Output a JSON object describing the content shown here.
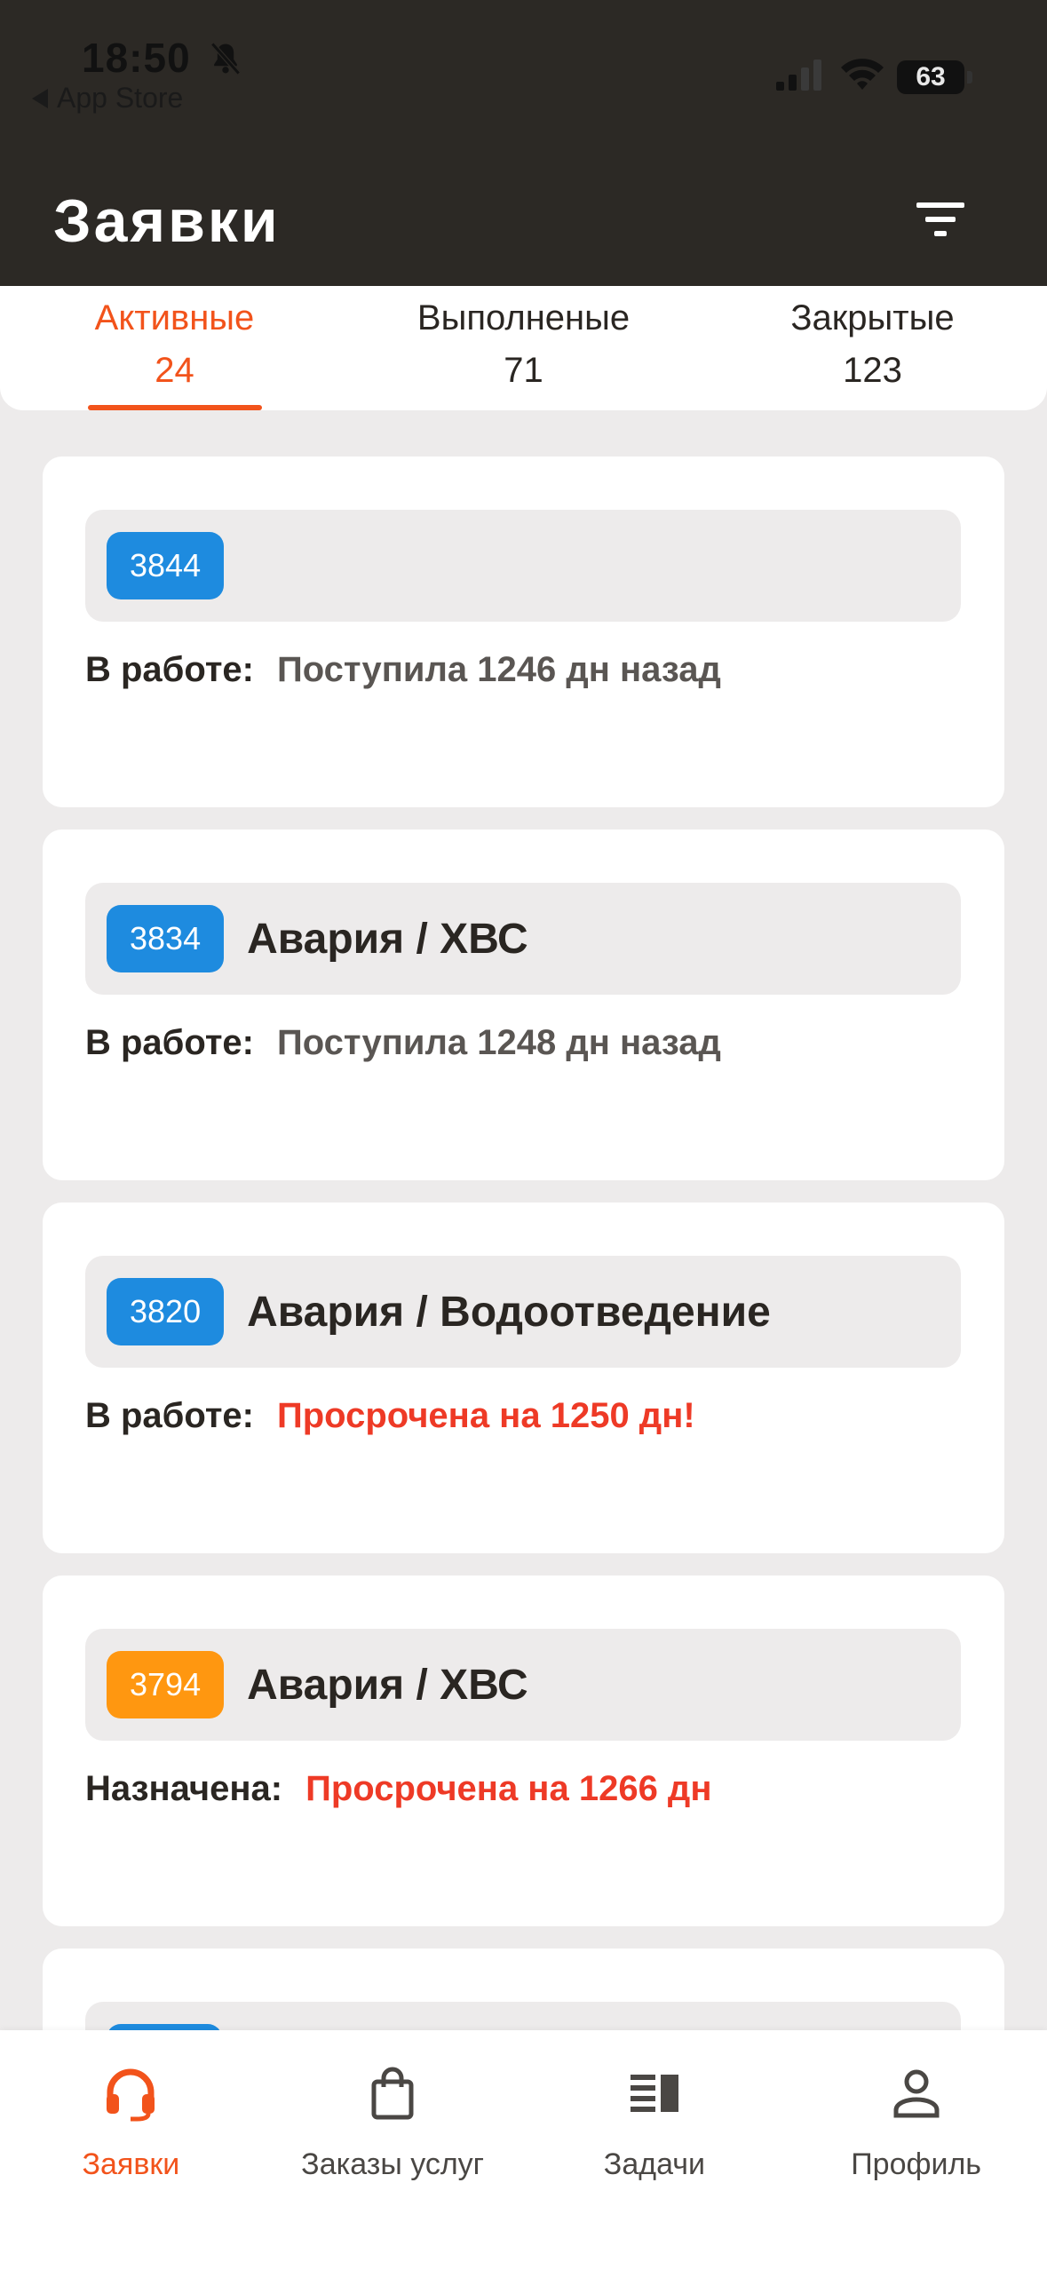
{
  "status_bar": {
    "time": "18:50",
    "back_app": "App Store",
    "battery": "63"
  },
  "header": {
    "title": "Заявки"
  },
  "tabs": [
    {
      "label": "Активные",
      "count": "24"
    },
    {
      "label": "Выполненые",
      "count": "71"
    },
    {
      "label": "Закрытые",
      "count": "123"
    }
  ],
  "requests": [
    {
      "number": "3844",
      "type": "",
      "status_label": "В работе:",
      "status_value": "Поступила 1246 дн назад",
      "badge_color": "#1e8bdf"
    },
    {
      "number": "3834",
      "type": "Авария / ХВС",
      "status_label": "В работе:",
      "status_value": "Поступила 1248 дн назад",
      "badge_color": "#1e8bdf"
    },
    {
      "number": "3820",
      "type": "Авария / Водоотведение",
      "status_label": "В работе:",
      "status_value": "Просрочена на 1250 дн!",
      "badge_color": "#1e8bdf"
    },
    {
      "number": "3794",
      "type": "Авария / ХВС",
      "status_label": "Назначена:",
      "status_value": "Просрочена на 1266 дн",
      "badge_color": "#ff9710"
    }
  ],
  "bottom_nav": [
    {
      "label": "Заявки",
      "icon": "headset-icon"
    },
    {
      "label": "Заказы услуг",
      "icon": "shopping-bag-icon"
    },
    {
      "label": "Задачи",
      "icon": "tasks-icon"
    },
    {
      "label": "Профиль",
      "icon": "profile-icon"
    }
  ],
  "colors": {
    "accent": "#f2531b",
    "header_bg": "#2c2925",
    "badge_blue": "#1e8bdf",
    "badge_orange": "#ff9710",
    "overdue": "#ee3a26"
  }
}
